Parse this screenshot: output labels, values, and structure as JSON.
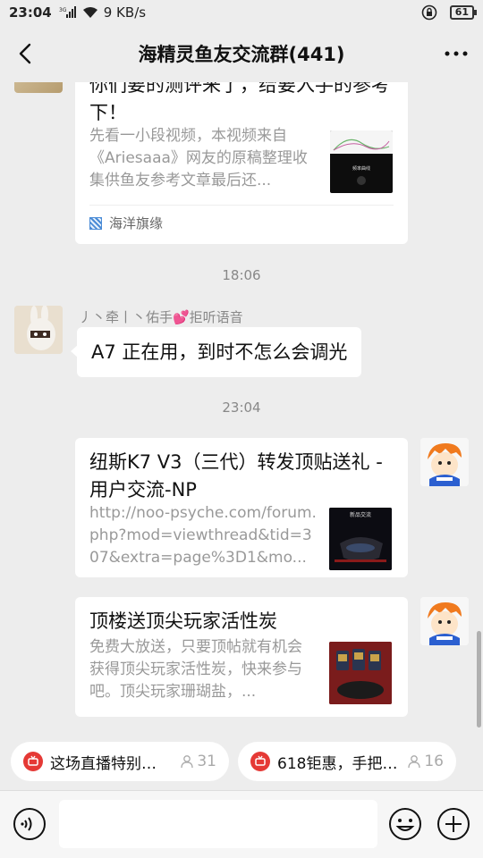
{
  "status": {
    "time": "23:04",
    "network": "9 KB/s",
    "battery": "61"
  },
  "header": {
    "title": "海精灵鱼友交流群(441)"
  },
  "messages": {
    "card1": {
      "title": "你们要的测评来了，给要入手的参考下！",
      "desc": "先看一小段视频，本视频来自《Ariesaaa》网友的原稿整理收集供鱼友参考文章最后还...",
      "thumb_label": "频率曲线",
      "source": "海洋旗缘"
    },
    "time1": "18:06",
    "text1": {
      "sender": "丿丶牵丨丶佑手💕拒听语音",
      "text": "A7 正在用，到时不怎么会调光"
    },
    "time2": "23:04",
    "card2": {
      "title": "纽斯K7 V3（三代）转发顶贴送礼 - 用户交流-NP",
      "desc": "http://noo-psyche.com/forum.php?mod=viewthread&tid=307&extra=page%3D1&mo...",
      "thumb_label": "新品交流"
    },
    "card3": {
      "title": "顶楼送顶尖玩家活性炭",
      "desc": "免费大放送，只要顶帖就有机会获得顶尖玩家活性炭，快来参与吧。顶尖玩家珊瑚盐，..."
    }
  },
  "live": [
    {
      "title": "这场直播特别…",
      "count": "31"
    },
    {
      "title": "618钜惠，手把…",
      "count": "16"
    }
  ],
  "colors": {
    "background": "#ededed",
    "bubble": "#ffffff",
    "live_red": "#e53935"
  }
}
